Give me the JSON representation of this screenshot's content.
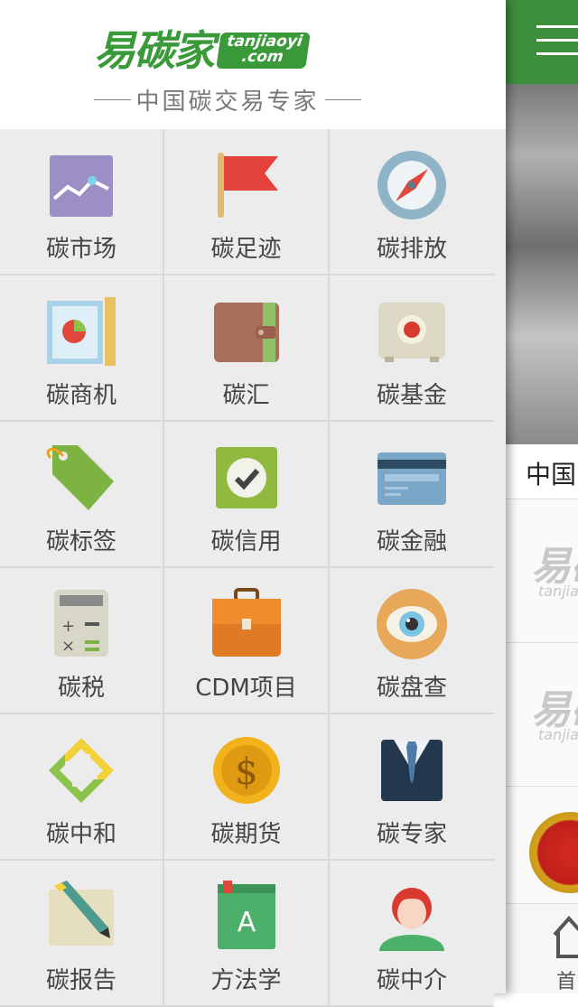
{
  "logo": {
    "chinese": "易碳家",
    "badge_line1": "tanjiaoyi",
    "badge_line2": ".com",
    "tagline": "中国碳交易专家"
  },
  "menu": [
    {
      "label": "碳市场",
      "icon": "market-chart-icon"
    },
    {
      "label": "碳足迹",
      "icon": "flag-icon"
    },
    {
      "label": "碳排放",
      "icon": "compass-icon"
    },
    {
      "label": "碳商机",
      "icon": "pie-chart-ruler-icon"
    },
    {
      "label": "碳汇",
      "icon": "wallet-icon"
    },
    {
      "label": "碳基金",
      "icon": "safe-icon"
    },
    {
      "label": "碳标签",
      "icon": "tag-icon"
    },
    {
      "label": "碳信用",
      "icon": "checkmark-icon"
    },
    {
      "label": "碳金融",
      "icon": "credit-card-icon"
    },
    {
      "label": "碳税",
      "icon": "calculator-icon"
    },
    {
      "label": "CDM项目",
      "icon": "briefcase-icon"
    },
    {
      "label": "碳盘查",
      "icon": "eye-icon"
    },
    {
      "label": "碳中和",
      "icon": "recycle-arrows-icon"
    },
    {
      "label": "碳期货",
      "icon": "dollar-coin-icon"
    },
    {
      "label": "碳专家",
      "icon": "suit-tie-icon"
    },
    {
      "label": "碳报告",
      "icon": "pencil-note-icon"
    },
    {
      "label": "方法学",
      "icon": "book-a-icon"
    },
    {
      "label": "碳中介",
      "icon": "person-icon"
    }
  ],
  "background_page": {
    "news_heading": "中国",
    "watermark": "易碳",
    "watermark_sub": "tanjia",
    "tab_home": "首"
  },
  "colors": {
    "brand_green": "#3e8f3c",
    "drawer_bg": "#ececec"
  }
}
